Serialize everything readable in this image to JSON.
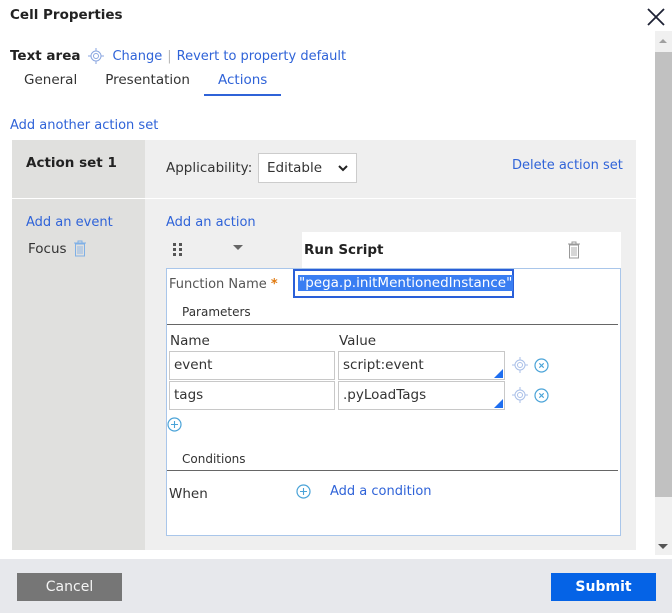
{
  "dialog": {
    "title": "Cell Properties",
    "close_icon": "close-icon"
  },
  "header": {
    "control_type": "Text area",
    "change_label": "Change",
    "separator": "|",
    "revert_label": "Revert to property default"
  },
  "tabs": [
    {
      "label": "General",
      "active": false
    },
    {
      "label": "Presentation",
      "active": false
    },
    {
      "label": "Actions",
      "active": true
    }
  ],
  "actions": {
    "add_action_set_label": "Add another action set",
    "action_set": {
      "title": "Action set 1",
      "applicability_label": "Applicability:",
      "applicability_value": "Editable",
      "delete_label": "Delete action set",
      "add_event_label": "Add an event",
      "events": [
        {
          "label": "Focus"
        }
      ],
      "add_action_label": "Add an action",
      "action": {
        "name": "Run Script",
        "function_name_label": "Function Name",
        "required_marker": "*",
        "function_name_value": "\"pega.p.initMentionedInstance\"",
        "parameters_label": "Parameters",
        "param_columns": [
          "Name",
          "Value"
        ],
        "parameters": [
          {
            "name": "event",
            "value": "script:event"
          },
          {
            "name": "tags",
            "value": ".pyLoadTags"
          }
        ],
        "conditions_label": "Conditions",
        "when_label": "When",
        "add_condition_label": "Add a condition"
      }
    }
  },
  "footer": {
    "cancel_label": "Cancel",
    "submit_label": "Submit"
  },
  "colors": {
    "accent": "#2f63d8",
    "submit": "#0563e6",
    "cancel": "#767676",
    "required": "#e07a10"
  }
}
